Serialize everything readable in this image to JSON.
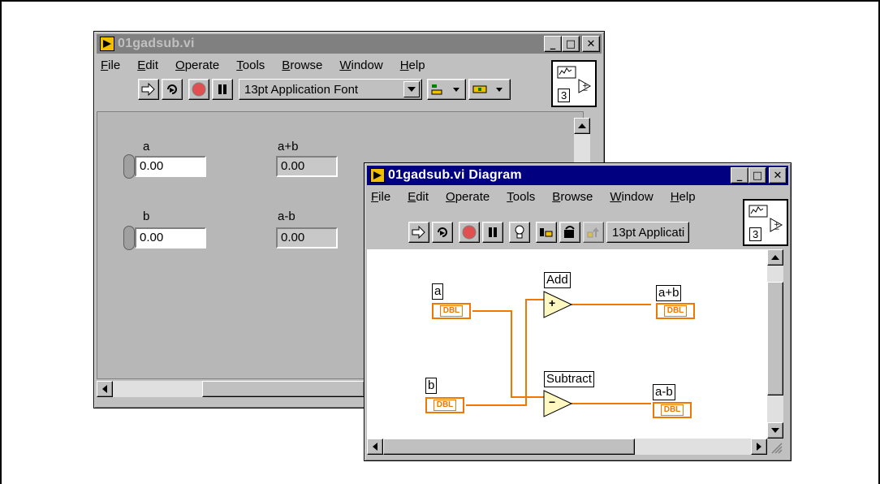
{
  "front_panel": {
    "title": "01gadsub.vi",
    "title_buttons": {
      "minimize": "_",
      "maximize": "□",
      "close": "✕"
    },
    "menu": [
      {
        "label": "File",
        "u": "F",
        "rest": "ile"
      },
      {
        "label": "Edit",
        "u": "E",
        "rest": "dit"
      },
      {
        "label": "Operate",
        "u": "O",
        "rest": "perate"
      },
      {
        "label": "Tools",
        "u": "T",
        "rest": "ools"
      },
      {
        "label": "Browse",
        "u": "B",
        "rest": "rowse"
      },
      {
        "label": "Window",
        "u": "W",
        "rest": "indow"
      },
      {
        "label": "Help",
        "u": "H",
        "rest": "elp"
      }
    ],
    "font_selector": "13pt Application Font",
    "connector_count": "3",
    "controls": {
      "a_label": "a",
      "a_value": "0.00",
      "b_label": "b",
      "b_value": "0.00",
      "sum_label": "a+b",
      "sum_value": "0.00",
      "diff_label": "a-b",
      "diff_value": "0.00"
    }
  },
  "block_diagram": {
    "title": "01gadsub.vi Diagram",
    "title_buttons": {
      "minimize": "_",
      "maximize": "□",
      "close": "✕"
    },
    "menu": [
      {
        "label": "File",
        "u": "F",
        "rest": "ile"
      },
      {
        "label": "Edit",
        "u": "E",
        "rest": "dit"
      },
      {
        "label": "Operate",
        "u": "O",
        "rest": "perate"
      },
      {
        "label": "Tools",
        "u": "T",
        "rest": "ools"
      },
      {
        "label": "Browse",
        "u": "B",
        "rest": "rowse"
      },
      {
        "label": "Window",
        "u": "W",
        "rest": "indow"
      },
      {
        "label": "Help",
        "u": "H",
        "rest": "elp"
      }
    ],
    "font_selector": "13pt Applicati",
    "connector_count": "3",
    "nodes": {
      "a_label": "a",
      "b_label": "b",
      "add_label": "Add",
      "subtract_label": "Subtract",
      "sum_label": "a+b",
      "diff_label": "a-b",
      "terminal_type": "DBL",
      "add_symbol": "+",
      "subtract_symbol": "−"
    }
  },
  "colors": {
    "wire": "#f07800",
    "titlebar_active": "#000080",
    "titlebar_inactive": "#808080"
  }
}
